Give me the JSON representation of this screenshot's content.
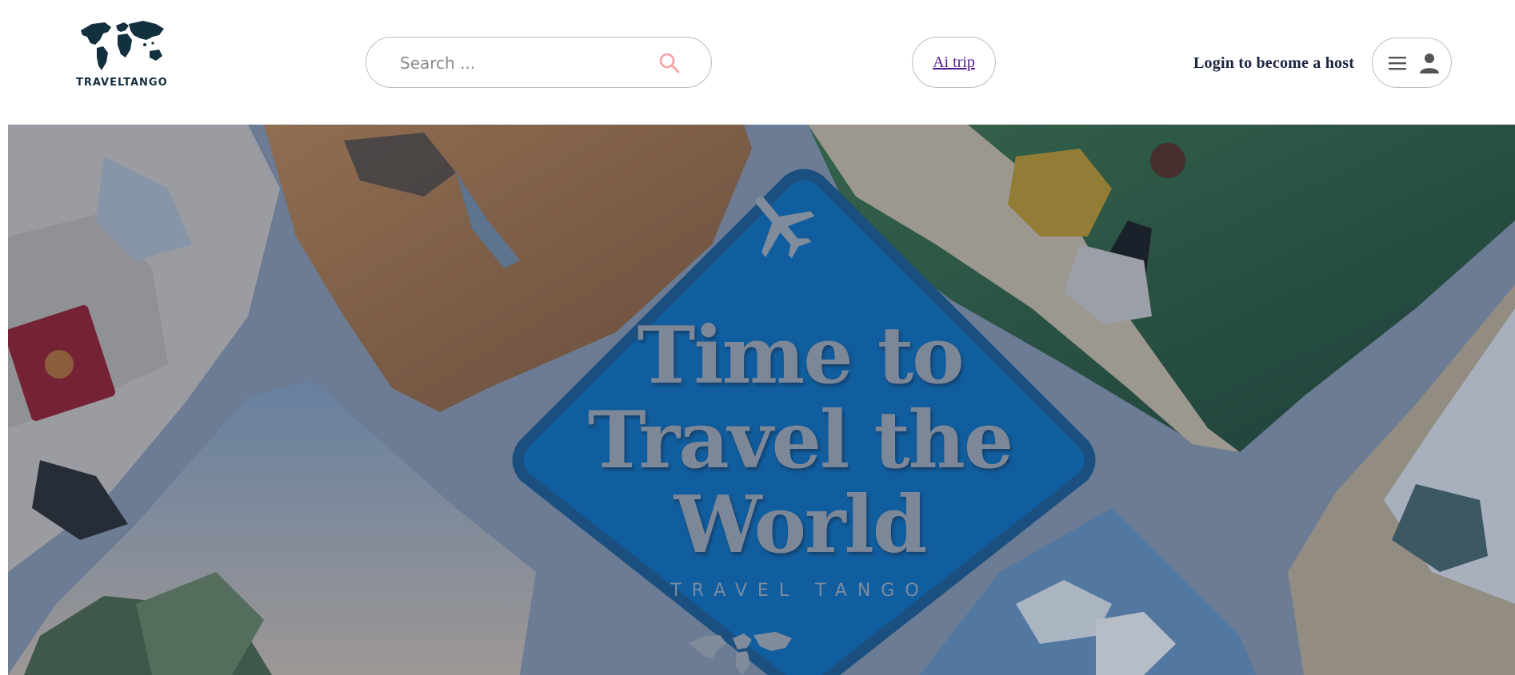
{
  "header": {
    "logo": {
      "icon": "world-map-icon",
      "text": "TRAVELTANGO"
    },
    "search": {
      "placeholder": "Search ...",
      "value": "",
      "icon": "search-icon",
      "icon_color": "#f4a3a6"
    },
    "ai_trip": {
      "label": "Ai trip"
    },
    "host_link": {
      "label": "Login to become a host"
    },
    "user_menu": {
      "menu_icon": "hamburger-menu-icon",
      "user_icon": "person-icon"
    }
  },
  "hero": {
    "title_lines": [
      "Time to",
      "Travel the",
      "World"
    ],
    "brand": "TRAVEL TANGO",
    "overlay_color": "#1e3250",
    "colors": {
      "center_diamond": "#0a73c4",
      "desert": "#b07a4b",
      "sweater": "#c9a02a",
      "forest": "#2c5a3a",
      "passport": "#9e1b27"
    },
    "icons": [
      "airplane-icon",
      "world-map-icon"
    ]
  }
}
